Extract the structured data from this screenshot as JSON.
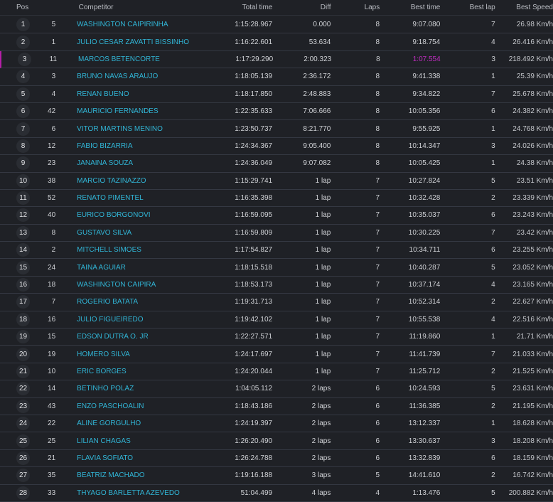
{
  "headers": {
    "pos": "Pos",
    "competitor": "Competitor",
    "total_time": "Total time",
    "diff": "Diff",
    "laps": "Laps",
    "best_time": "Best time",
    "best_lap": "Best lap",
    "best_speed": "Best Speed"
  },
  "colors": {
    "background": "#1f2126",
    "link": "#31b5d6",
    "highlight": "#c02cc0",
    "highlight_border": "#b51fa8",
    "badge": "#2a2d33"
  },
  "rows": [
    {
      "pos": "1",
      "num": "5",
      "competitor": "WASHINGTON CAIPIRINHA",
      "total_time": "1:15:28.967",
      "diff": "0.000",
      "laps": "8",
      "best_time": "9:07.080",
      "best_lap": "7",
      "best_speed": "26.98 Km/h"
    },
    {
      "pos": "2",
      "num": "1",
      "competitor": "JULIO CESAR ZAVATTI BISSINHO",
      "total_time": "1:16:22.601",
      "diff": "53.634",
      "laps": "8",
      "best_time": "9:18.754",
      "best_lap": "4",
      "best_speed": "26.416 Km/h"
    },
    {
      "pos": "3",
      "num": "11",
      "competitor": "MARCOS BETENCORTE",
      "total_time": "1:17:29.290",
      "diff": "2:00.323",
      "laps": "8",
      "best_time": "1:07.554",
      "best_lap": "3",
      "best_speed": "218.492 Km/h",
      "highlight": true
    },
    {
      "pos": "4",
      "num": "3",
      "competitor": "BRUNO NAVAS ARAUJO",
      "total_time": "1:18:05.139",
      "diff": "2:36.172",
      "laps": "8",
      "best_time": "9:41.338",
      "best_lap": "1",
      "best_speed": "25.39 Km/h"
    },
    {
      "pos": "5",
      "num": "4",
      "competitor": "RENAN BUENO",
      "total_time": "1:18:17.850",
      "diff": "2:48.883",
      "laps": "8",
      "best_time": "9:34.822",
      "best_lap": "7",
      "best_speed": "25.678 Km/h"
    },
    {
      "pos": "6",
      "num": "42",
      "competitor": "MAURICIO FERNANDES",
      "total_time": "1:22:35.633",
      "diff": "7:06.666",
      "laps": "8",
      "best_time": "10:05.356",
      "best_lap": "6",
      "best_speed": "24.382 Km/h"
    },
    {
      "pos": "7",
      "num": "6",
      "competitor": "VITOR MARTINS MENINO",
      "total_time": "1:23:50.737",
      "diff": "8:21.770",
      "laps": "8",
      "best_time": "9:55.925",
      "best_lap": "1",
      "best_speed": "24.768 Km/h"
    },
    {
      "pos": "8",
      "num": "12",
      "competitor": "FABIO BIZARRIA",
      "total_time": "1:24:34.367",
      "diff": "9:05.400",
      "laps": "8",
      "best_time": "10:14.347",
      "best_lap": "3",
      "best_speed": "24.026 Km/h"
    },
    {
      "pos": "9",
      "num": "23",
      "competitor": "JANAINA SOUZA",
      "total_time": "1:24:36.049",
      "diff": "9:07.082",
      "laps": "8",
      "best_time": "10:05.425",
      "best_lap": "1",
      "best_speed": "24.38 Km/h"
    },
    {
      "pos": "10",
      "num": "38",
      "competitor": "MARCIO TAZINAZZO",
      "total_time": "1:15:29.741",
      "diff": "1 lap",
      "laps": "7",
      "best_time": "10:27.824",
      "best_lap": "5",
      "best_speed": "23.51 Km/h"
    },
    {
      "pos": "11",
      "num": "52",
      "competitor": "RENATO PIMENTEL",
      "total_time": "1:16:35.398",
      "diff": "1 lap",
      "laps": "7",
      "best_time": "10:32.428",
      "best_lap": "2",
      "best_speed": "23.339 Km/h"
    },
    {
      "pos": "12",
      "num": "40",
      "competitor": "EURICO BORGONOVI",
      "total_time": "1:16:59.095",
      "diff": "1 lap",
      "laps": "7",
      "best_time": "10:35.037",
      "best_lap": "6",
      "best_speed": "23.243 Km/h"
    },
    {
      "pos": "13",
      "num": "8",
      "competitor": "GUSTAVO SILVA",
      "total_time": "1:16:59.809",
      "diff": "1 lap",
      "laps": "7",
      "best_time": "10:30.225",
      "best_lap": "7",
      "best_speed": "23.42 Km/h"
    },
    {
      "pos": "14",
      "num": "2",
      "competitor": "MITCHELL SIMOES",
      "total_time": "1:17:54.827",
      "diff": "1 lap",
      "laps": "7",
      "best_time": "10:34.711",
      "best_lap": "6",
      "best_speed": "23.255 Km/h"
    },
    {
      "pos": "15",
      "num": "24",
      "competitor": "TAINA AGUIAR",
      "total_time": "1:18:15.518",
      "diff": "1 lap",
      "laps": "7",
      "best_time": "10:40.287",
      "best_lap": "5",
      "best_speed": "23.052 Km/h"
    },
    {
      "pos": "16",
      "num": "18",
      "competitor": "WASHINGTON CAIPIRA",
      "total_time": "1:18:53.173",
      "diff": "1 lap",
      "laps": "7",
      "best_time": "10:37.174",
      "best_lap": "4",
      "best_speed": "23.165 Km/h"
    },
    {
      "pos": "17",
      "num": "7",
      "competitor": "ROGERIO BATATA",
      "total_time": "1:19:31.713",
      "diff": "1 lap",
      "laps": "7",
      "best_time": "10:52.314",
      "best_lap": "2",
      "best_speed": "22.627 Km/h"
    },
    {
      "pos": "18",
      "num": "16",
      "competitor": "JULIO FIGUEIREDO",
      "total_time": "1:19:42.102",
      "diff": "1 lap",
      "laps": "7",
      "best_time": "10:55.538",
      "best_lap": "4",
      "best_speed": "22.516 Km/h"
    },
    {
      "pos": "19",
      "num": "15",
      "competitor": "EDSON DUTRA O. JR",
      "total_time": "1:22:27.571",
      "diff": "1 lap",
      "laps": "7",
      "best_time": "11:19.860",
      "best_lap": "1",
      "best_speed": "21.71 Km/h"
    },
    {
      "pos": "20",
      "num": "19",
      "competitor": "HOMERO SILVA",
      "total_time": "1:24:17.697",
      "diff": "1 lap",
      "laps": "7",
      "best_time": "11:41.739",
      "best_lap": "7",
      "best_speed": "21.033 Km/h"
    },
    {
      "pos": "21",
      "num": "10",
      "competitor": "ERIC BORGES",
      "total_time": "1:24:20.044",
      "diff": "1 lap",
      "laps": "7",
      "best_time": "11:25.712",
      "best_lap": "2",
      "best_speed": "21.525 Km/h"
    },
    {
      "pos": "22",
      "num": "14",
      "competitor": "BETINHO POLAZ",
      "total_time": "1:04:05.112",
      "diff": "2 laps",
      "laps": "6",
      "best_time": "10:24.593",
      "best_lap": "5",
      "best_speed": "23.631 Km/h"
    },
    {
      "pos": "23",
      "num": "43",
      "competitor": "ENZO PASCHOALIN",
      "total_time": "1:18:43.186",
      "diff": "2 laps",
      "laps": "6",
      "best_time": "11:36.385",
      "best_lap": "2",
      "best_speed": "21.195 Km/h"
    },
    {
      "pos": "24",
      "num": "22",
      "competitor": "ALINE GORGULHO",
      "total_time": "1:24:19.397",
      "diff": "2 laps",
      "laps": "6",
      "best_time": "13:12.337",
      "best_lap": "1",
      "best_speed": "18.628 Km/h"
    },
    {
      "pos": "25",
      "num": "25",
      "competitor": "LILIAN CHAGAS",
      "total_time": "1:26:20.490",
      "diff": "2 laps",
      "laps": "6",
      "best_time": "13:30.637",
      "best_lap": "3",
      "best_speed": "18.208 Km/h"
    },
    {
      "pos": "26",
      "num": "21",
      "competitor": "FLAVIA SOFIATO",
      "total_time": "1:26:24.788",
      "diff": "2 laps",
      "laps": "6",
      "best_time": "13:32.839",
      "best_lap": "6",
      "best_speed": "18.159 Km/h"
    },
    {
      "pos": "27",
      "num": "35",
      "competitor": "BEATRIZ MACHADO",
      "total_time": "1:19:16.188",
      "diff": "3 laps",
      "laps": "5",
      "best_time": "14:41.610",
      "best_lap": "2",
      "best_speed": "16.742 Km/h"
    },
    {
      "pos": "28",
      "num": "33",
      "competitor": "THYAGO BARLETTA AZEVEDO",
      "total_time": "51:04.499",
      "diff": "4 laps",
      "laps": "4",
      "best_time": "1:13.476",
      "best_lap": "5",
      "best_speed": "200.882 Km/h"
    }
  ]
}
